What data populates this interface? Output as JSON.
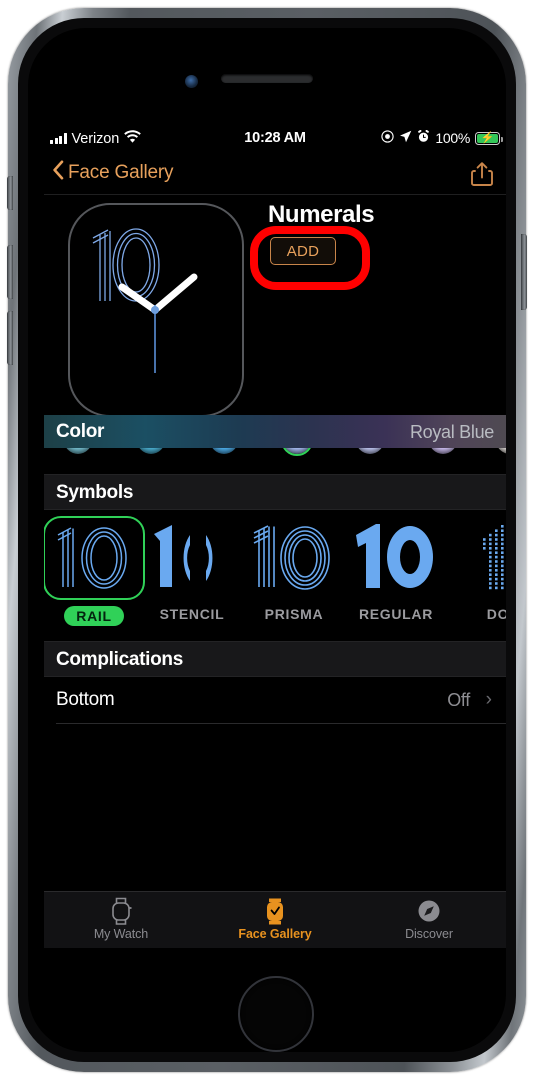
{
  "device": {
    "frame_color": "#6e7378",
    "buttons": [
      "mute-switch",
      "volume-up",
      "volume-down",
      "power-button"
    ],
    "home_button": "home-button"
  },
  "status_bar": {
    "signal_icon": "cellular-signal-icon",
    "carrier": "Verizon",
    "wifi_icon": "wifi-icon",
    "time": "10:28 AM",
    "right_icons": [
      "do-not-disturb-icon",
      "location-arrow-icon",
      "alarm-clock-icon"
    ],
    "battery_percent": "100%",
    "battery_charging": true,
    "battery_color": "#34c759"
  },
  "nav_bar": {
    "back_label": "Face Gallery",
    "back_icon": "chevron-left-icon",
    "share_icon": "share-icon",
    "accent_color": "#e8a15c"
  },
  "preview": {
    "watch_face_time": "10",
    "face_title": "Numerals",
    "add_label": "ADD",
    "highlight_color": "#ff0000",
    "numeral_color": "#7fa9e8",
    "hand_color": "#ffffff",
    "second_hand_color": "#5a8fd6"
  },
  "color_section": {
    "label": "Color",
    "value": "Royal Blue",
    "selected_index": 3,
    "selection_ring_color": "#30d158",
    "swatches": [
      "#6fb6c6",
      "#47a8c8",
      "#4aa6e0",
      "#9fb4e8",
      "#b6bde6",
      "#c2b4e4",
      "#d8d4d0"
    ]
  },
  "symbols_section": {
    "label": "Symbols",
    "selected_index": 0,
    "items": [
      {
        "label": "RAIL",
        "style": "rail",
        "digits": "10",
        "selected": true
      },
      {
        "label": "STENCIL",
        "style": "stencil",
        "digits": "10",
        "selected": false
      },
      {
        "label": "PRISMA",
        "style": "prisma",
        "digits": "10",
        "selected": false
      },
      {
        "label": "REGULAR",
        "style": "regular",
        "digits": "10",
        "selected": false
      },
      {
        "label": "DO",
        "style": "dot",
        "digits": "1",
        "selected": false
      }
    ]
  },
  "complications_section": {
    "label": "Complications",
    "rows": [
      {
        "label": "Bottom",
        "value": "Off",
        "chevron": "›"
      }
    ]
  },
  "tab_bar": {
    "active_index": 1,
    "active_color": "#e8921f",
    "inactive_color": "#8b8b90",
    "tabs": [
      {
        "label": "My Watch",
        "icon": "watch-outline-icon"
      },
      {
        "label": "Face Gallery",
        "icon": "watch-filled-icon"
      },
      {
        "label": "Discover",
        "icon": "compass-icon"
      }
    ]
  }
}
